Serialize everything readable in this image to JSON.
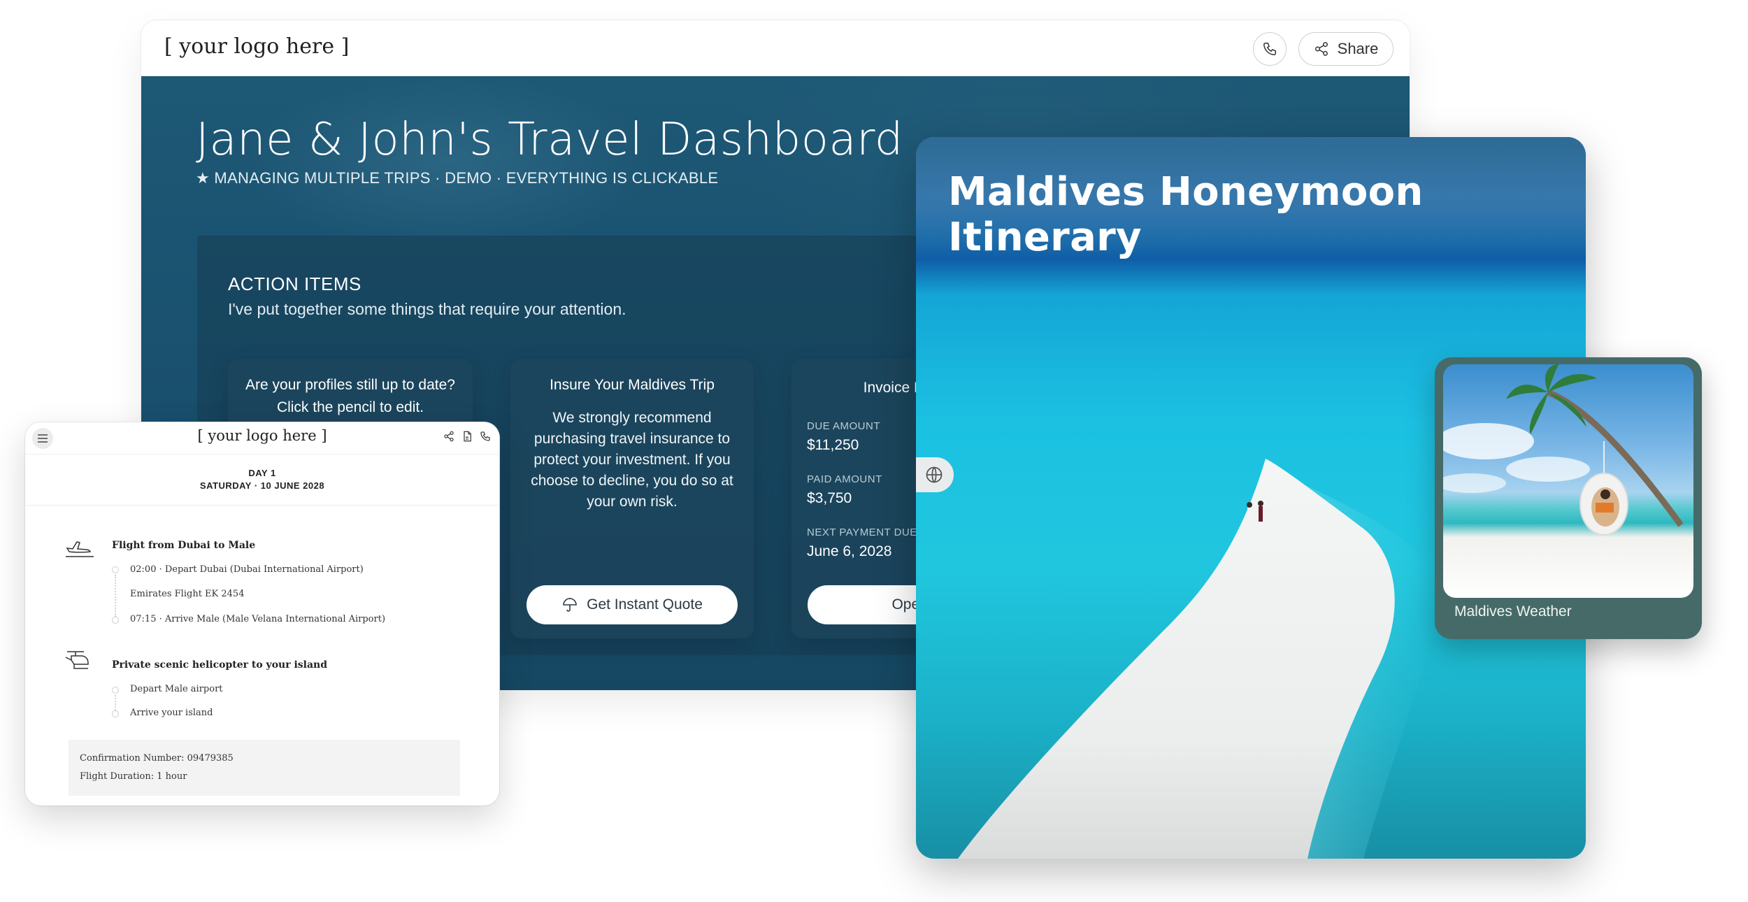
{
  "dashboard": {
    "logo": "[ your logo here ]",
    "share_label": "Share",
    "title": "Jane & John's Travel Dashboard",
    "subtitle": "★ MANAGING MULTIPLE TRIPS · DEMO · EVERYTHING IS CLICKABLE",
    "action_items": {
      "title": "ACTION ITEMS",
      "description": "I've put together some things that require your attention.",
      "cards": [
        {
          "heading": "Are your profiles still up to date? Click the pencil to edit."
        },
        {
          "heading": "Insure Your Maldives Trip",
          "body": "We strongly recommend purchasing travel insurance to protect your investment. If you choose to decline, you do so at your own risk.",
          "button": "Get Instant Quote"
        },
        {
          "heading": "Invoice For You",
          "due_label": "DUE AMOUNT",
          "due_value": "$11,250",
          "paid_label": "PAID AMOUNT",
          "paid_value": "$3,750",
          "next_label": "NEXT PAYMENT DUE",
          "next_value": "June 6, 2028",
          "button": "Open I"
        }
      ]
    }
  },
  "itinerary": {
    "logo": "[ your logo here ]",
    "day_label": "DAY 1",
    "day_date": "SATURDAY · 10 JUNE 2028",
    "segments": [
      {
        "icon": "plane-icon",
        "title": "Flight from Dubai to Male",
        "lines": [
          "02:00 · Depart Dubai (Dubai International Airport)",
          "Emirates Flight EK 2454",
          "07:15 · Arrive Male (Male Velana International Airport)"
        ]
      },
      {
        "icon": "helicopter-icon",
        "title": "Private scenic helicopter to your island",
        "lines": [
          "Depart Male airport",
          "Arrive your island"
        ]
      }
    ],
    "confirmation": "Confirmation Number: 09479385",
    "duration": "Flight Duration: 1 hour"
  },
  "maldives": {
    "title": "Maldives Honeymoon Itinerary"
  },
  "weather": {
    "label": "Maldives Weather"
  },
  "colors": {
    "hero_blue": "#1a5270",
    "weather_card": "#466a68",
    "sea_turquoise": "#1cc1e2"
  }
}
